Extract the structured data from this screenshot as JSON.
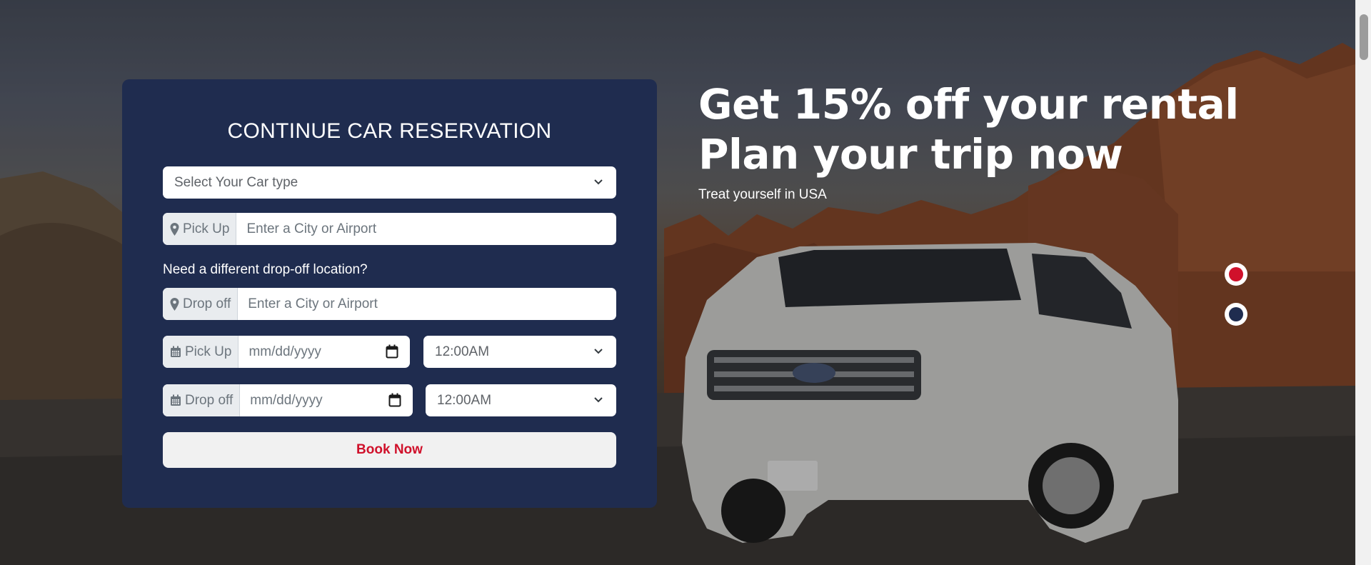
{
  "form": {
    "title": "CONTINUE CAR RESERVATION",
    "car_type": {
      "placeholder": "Select Your Car type"
    },
    "pickup_location": {
      "label": "Pick Up",
      "placeholder": "Enter a City or Airport"
    },
    "dropoff_question": "Need a different drop-off location?",
    "dropoff_location": {
      "label": "Drop off",
      "placeholder": "Enter a City or Airport"
    },
    "pickup_datetime": {
      "label": "Pick Up",
      "date_placeholder": "mm/dd/yyyy",
      "time_value": "12:00AM"
    },
    "dropoff_datetime": {
      "label": "Drop off",
      "date_placeholder": "mm/dd/yyyy",
      "time_value": "12:00AM"
    },
    "book_label": "Book Now"
  },
  "promo": {
    "headline_line1": "Get 15% off your rental",
    "headline_line2": "Plan your trip now",
    "subtext": "Treat yourself in USA"
  },
  "carousel": {
    "slides": 2,
    "active_index": 0,
    "active_color": "#d0112b",
    "inactive_color": "#1f2c4f"
  },
  "icons": {
    "location": "map-marker-icon",
    "calendar": "calendar-icon",
    "chevron": "chevron-down-icon"
  },
  "colors": {
    "card_bg": "#1f2c4f",
    "accent_red": "#d0112b",
    "button_bg": "#f1f1f1"
  }
}
